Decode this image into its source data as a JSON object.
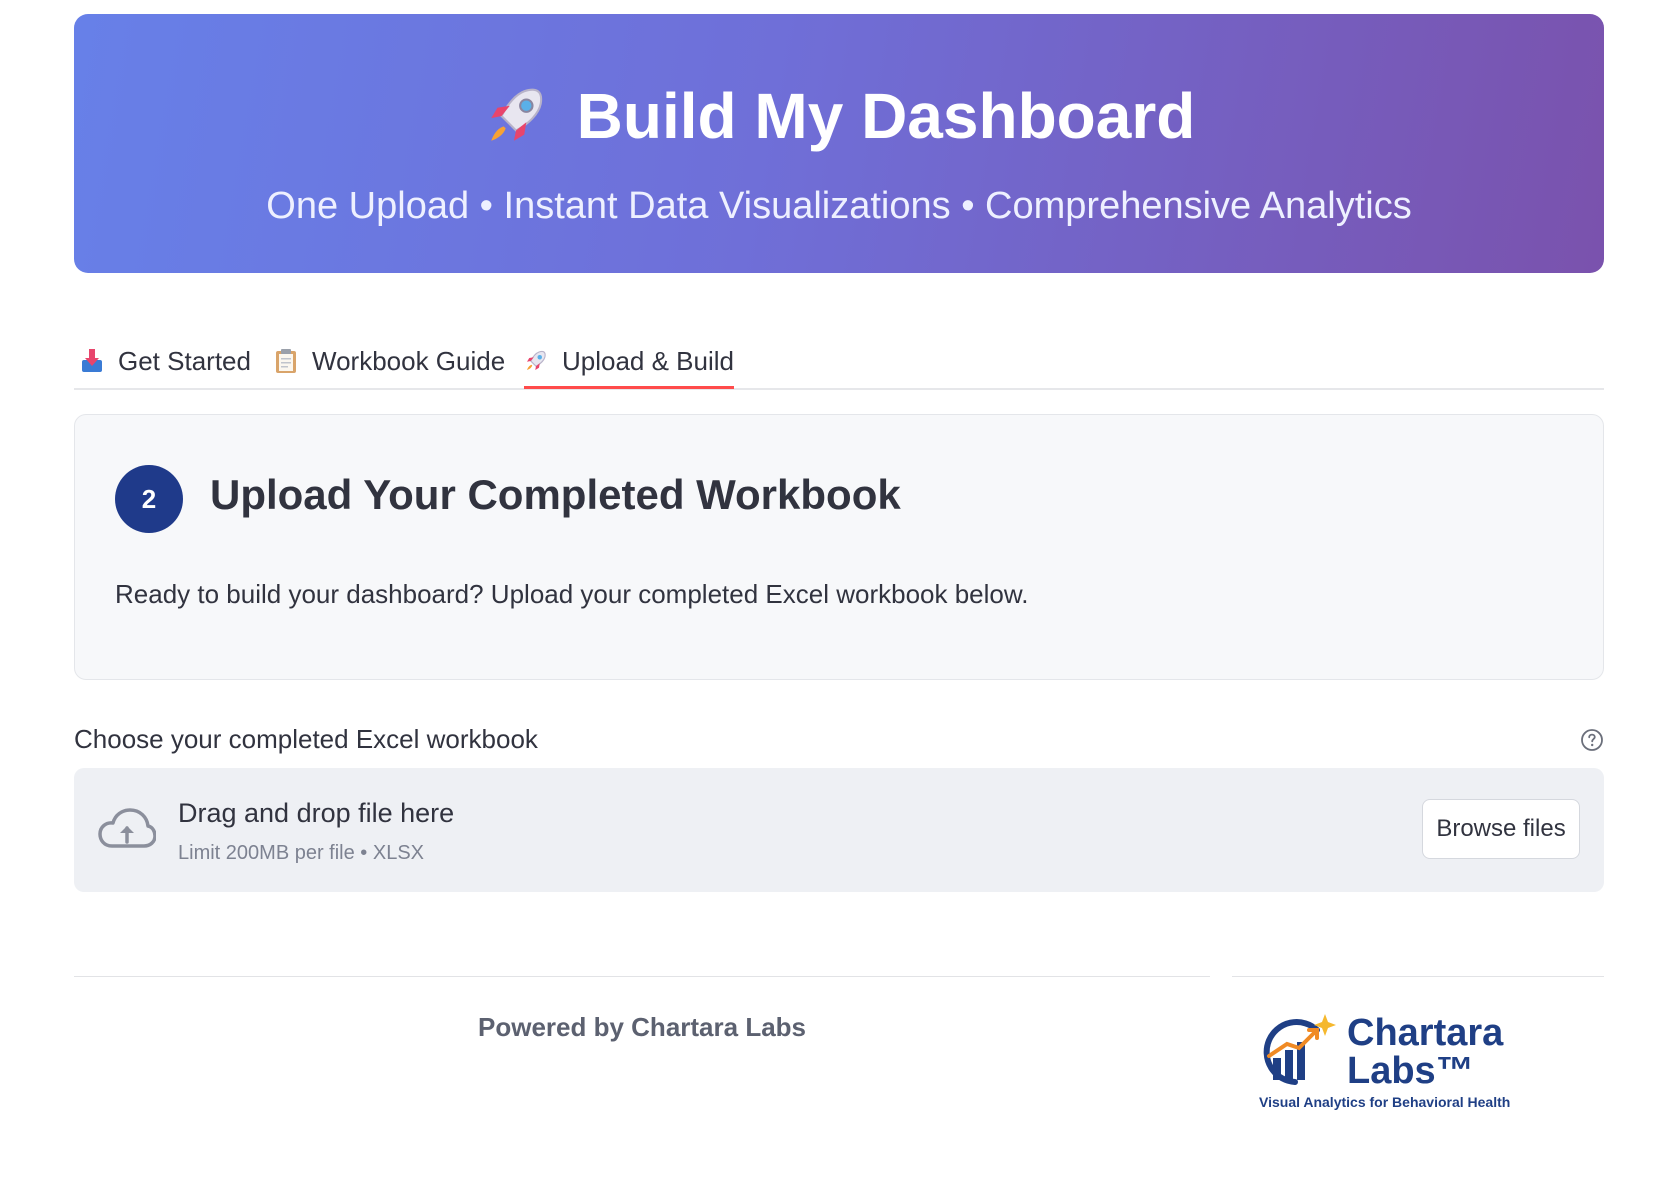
{
  "header": {
    "icon": "rocket-icon",
    "title": "Build My Dashboard",
    "subtitle": "One Upload • Instant Data Visualizations • Comprehensive Analytics"
  },
  "tabs": [
    {
      "label": "Get Started",
      "icon": "inbox-tray-icon",
      "active": false
    },
    {
      "label": "Workbook Guide",
      "icon": "clipboard-icon",
      "active": false
    },
    {
      "label": "Upload & Build",
      "icon": "rocket-icon",
      "active": true
    }
  ],
  "step_card": {
    "step_number": "2",
    "title": "Upload Your Completed Workbook",
    "text": "Ready to build your dashboard? Upload your completed Excel workbook below."
  },
  "uploader": {
    "label": "Choose your completed Excel workbook",
    "drop_text": "Drag and drop file here",
    "limit_text": "Limit 200MB per file • XLSX",
    "button_label": "Browse files"
  },
  "footer": {
    "powered_by": "Powered by Chartara Labs",
    "logo_name_line1": "Chartara",
    "logo_name_line2": "Labs™",
    "logo_tagline": "Visual Analytics for Behavioral Health"
  },
  "colors": {
    "header_gradient_start": "#6780e8",
    "header_gradient_end": "#7a52ad",
    "active_tab_underline": "#ff4b4b",
    "step_badge": "#1f3a8a",
    "logo_blue": "#1f3f85",
    "logo_orange": "#f08a24"
  }
}
